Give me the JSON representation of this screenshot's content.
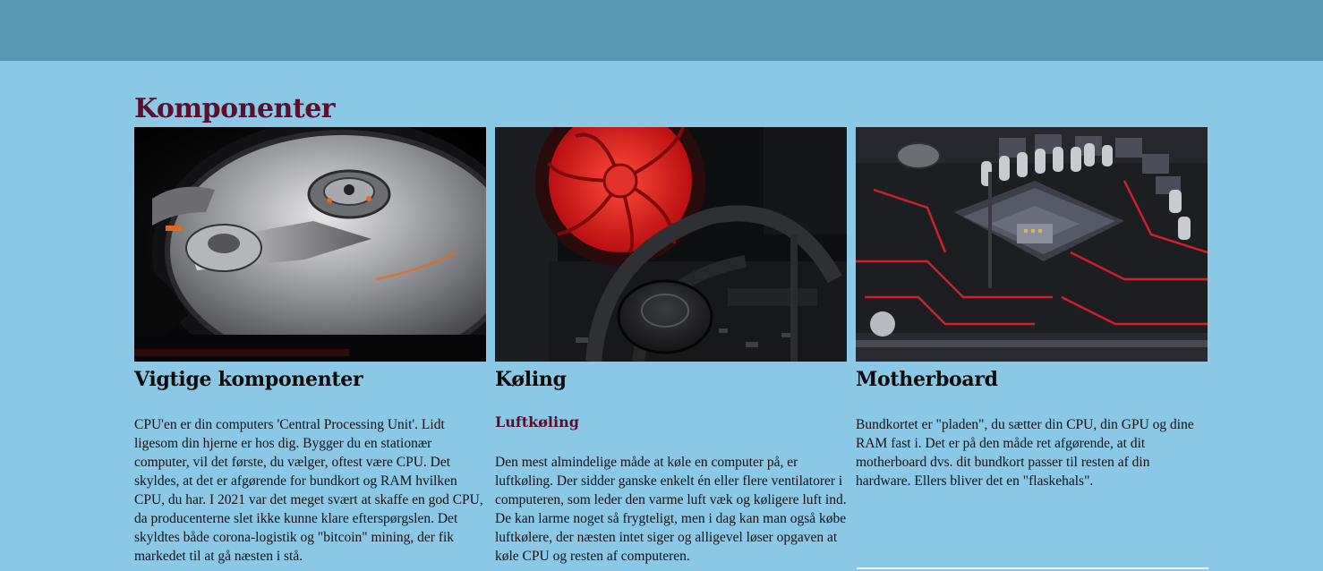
{
  "page": {
    "title": "Komponenter"
  },
  "cards": [
    {
      "image": "hard-drive-photo",
      "title": "Vigtige komponenter",
      "text": "CPU'en er din computers 'Central Processing Unit'. Lidt ligesom din hjerne er hos dig. Bygger du en stationær computer, vil det første, du vælger, oftest være CPU. Det skyldes, at det er afgørende for bundkort og RAM hvilken CPU, du har. I 2021 var det meget svært at skaffe en god CPU, da producenterne slet ikke kunne klare efterspørgslen. Det skyldtes både corona-logistik og \"bitcoin\" mining, der fik markedet til at gå næsten i stå."
    },
    {
      "image": "cpu-cooler-photo",
      "title": "Køling",
      "subtitle": "Luftkøling",
      "text": "Den mest almindelige måde at køle en computer på, er luftkøling. Der sidder ganske enkelt én eller flere ventilatorer i computeren, som leder den varme luft væk og køligere luft ind. De kan larme noget så frygteligt, men i dag kan man også købe luftkølere, der næsten intet siger og alligevel løser opgaven at køle CPU og resten af computeren."
    },
    {
      "image": "motherboard-photo",
      "title": "Motherboard",
      "text": "Bundkortet er \"pladen\", du sætter din CPU, din GPU og dine RAM fast i. Det er på den måde ret afgørende, at dit motherboard dvs. dit bundkort passer til resten af din hardware. Ellers bliver det en \"flaskehals\"."
    }
  ],
  "colors": {
    "background": "#8ac8e6",
    "topbar": "#5896b2",
    "accent": "#5a0f2b"
  }
}
